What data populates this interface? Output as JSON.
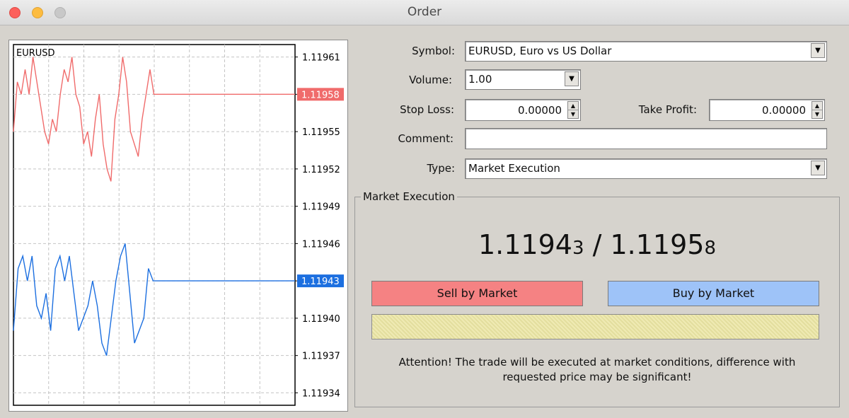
{
  "window": {
    "title": "Order"
  },
  "chart": {
    "symbol": "EURUSD",
    "price_levels": [
      "1.11961",
      "1.11958",
      "1.11955",
      "1.11952",
      "1.11949",
      "1.11946",
      "1.11943",
      "1.11940",
      "1.11937",
      "1.11934"
    ],
    "ask_label": "1.11958",
    "bid_label": "1.11943",
    "ask_color": "#f06b6b",
    "bid_color": "#1c6fe0",
    "ask_series": [
      1.11955,
      1.11959,
      1.11958,
      1.1196,
      1.11958,
      1.11961,
      1.11959,
      1.11957,
      1.11955,
      1.11954,
      1.11956,
      1.11955,
      1.11958,
      1.1196,
      1.11959,
      1.11961,
      1.11958,
      1.11957,
      1.11954,
      1.11955,
      1.11953,
      1.11956,
      1.11958,
      1.11954,
      1.11952,
      1.11951,
      1.11956,
      1.11958,
      1.11961,
      1.11959,
      1.11955,
      1.11954,
      1.11953,
      1.11956,
      1.11958,
      1.1196,
      1.11958,
      1.11958
    ],
    "bid_series": [
      1.11939,
      1.11944,
      1.11945,
      1.11943,
      1.11945,
      1.11941,
      1.1194,
      1.11942,
      1.11939,
      1.11944,
      1.11945,
      1.11943,
      1.11945,
      1.11942,
      1.11939,
      1.1194,
      1.11941,
      1.11943,
      1.11941,
      1.11938,
      1.11937,
      1.1194,
      1.11943,
      1.11945,
      1.11946,
      1.11942,
      1.11938,
      1.11939,
      1.1194,
      1.11944,
      1.11943,
      1.11943
    ]
  },
  "form": {
    "symbol_label": "Symbol:",
    "symbol_value": "EURUSD, Euro vs US Dollar",
    "volume_label": "Volume:",
    "volume_value": "1.00",
    "stop_loss_label": "Stop Loss:",
    "stop_loss_value": "0.00000",
    "take_profit_label": "Take Profit:",
    "take_profit_value": "0.00000",
    "comment_label": "Comment:",
    "comment_value": "",
    "type_label": "Type:",
    "type_value": "Market Execution"
  },
  "execution": {
    "group_title": "Market Execution",
    "bid_main": "1.1194",
    "bid_last": "3",
    "separator": " / ",
    "ask_main": "1.1195",
    "ask_last": "8",
    "sell_label": "Sell by Market",
    "buy_label": "Buy by Market",
    "sell_color": "#f58283",
    "buy_color": "#9ec3f8",
    "attention_line1": "Attention! The trade will be executed at market conditions, difference with",
    "attention_line2": "requested price may be significant!"
  }
}
